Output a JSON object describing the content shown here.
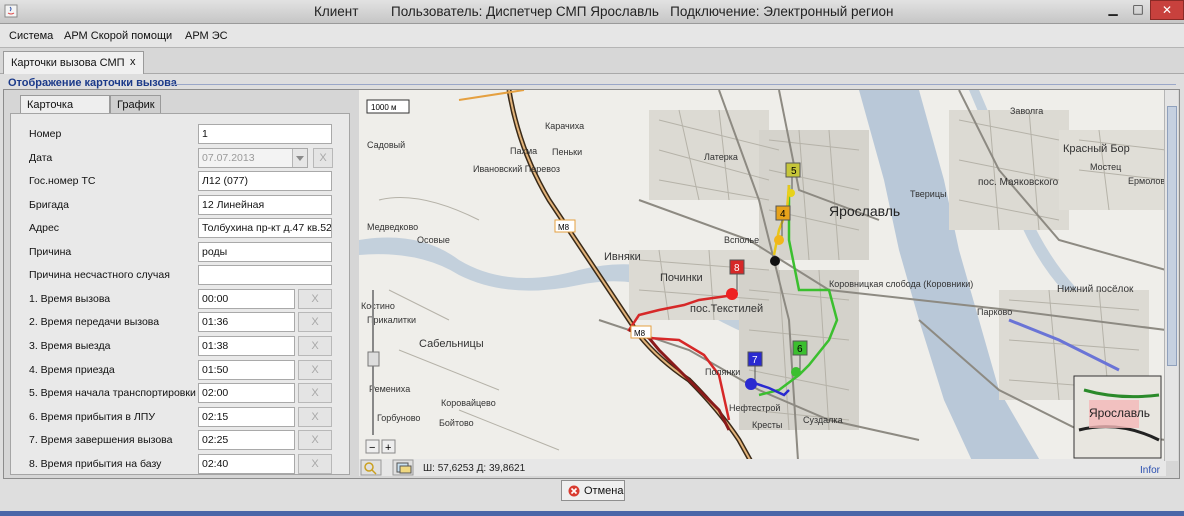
{
  "window": {
    "app_title": "Клиент",
    "session_info": "Пользователь: Диспетчер СМП Ярославль   Подключение: Электронный регион",
    "minimize_glyph": "▁",
    "maximize_glyph": "□",
    "close_glyph": "✕"
  },
  "menu": [
    "Система",
    "АРМ Скорой помощи",
    "АРМ ЭС"
  ],
  "doc_tab": {
    "label": "Карточки вызова СМП",
    "close": "x"
  },
  "section_title": "Отображение карточки вызова",
  "form_tabs": [
    "Карточка вызова",
    "График"
  ],
  "form": {
    "clear_label": "X",
    "fields": [
      {
        "label": "Номер",
        "value": "1"
      },
      {
        "label": "Дата",
        "value": "07.07.2013",
        "disabled": true
      },
      {
        "label": "Гос.номер ТС",
        "value": "Л12 (077)"
      },
      {
        "label": "Бригада",
        "value": "12 Линейная"
      },
      {
        "label": "Адрес",
        "value": "Толбухина пр-кт д.47 кв.52"
      },
      {
        "label": "Причина",
        "value": "роды"
      },
      {
        "label": "Причина несчастного случая",
        "value": ""
      },
      {
        "label": "1. Время вызова",
        "value": "00:00"
      },
      {
        "label": "2. Время передачи вызова",
        "value": "01:36"
      },
      {
        "label": "3. Время выезда",
        "value": "01:38"
      },
      {
        "label": "4. Время приезда",
        "value": "01:50"
      },
      {
        "label": "5. Время начала транспортировки",
        "value": "02:00"
      },
      {
        "label": "6. Время прибытия в ЛПУ",
        "value": "02:15"
      },
      {
        "label": "7. Время завершения вызова",
        "value": "02:25"
      },
      {
        "label": "8. Время прибытия на базу",
        "value": "02:40"
      }
    ]
  },
  "map": {
    "scale_label": "1000 м",
    "coords": "Ш: 57,6253  Д: 39,8621",
    "info_link": "Infor",
    "zoom_in": "+",
    "zoom_out": "−",
    "places": [
      "Карачиха",
      "Пахма",
      "Пеньки",
      "Садовый",
      "Ивановский Перевоз",
      "Медведково",
      "Осовые",
      "Ивняки",
      "Починки",
      "пос.Текстилей",
      "Сабельницы",
      "Костино",
      "Прикалитки",
      "Ремениха",
      "Горбуново",
      "Коровайцево",
      "Бойтово",
      "Полянки",
      "Нефтестрой",
      "Кресты",
      "Суздалка",
      "Латерка",
      "Всполье",
      "Ярославль",
      "Тверицы",
      "Коровницкая слобода (Коровники)",
      "Заволга",
      "Красный Бор",
      "Мостец",
      "Ермолово",
      "пос. Маяковского",
      "Нижний посёлок",
      "Парково"
    ],
    "road_labels": [
      "M8",
      "M8"
    ],
    "minimap_label": "Ярославль",
    "markers": [
      {
        "n": "5",
        "color": "#c6c63a"
      },
      {
        "n": "4",
        "color": "#e7a21a"
      },
      {
        "n": "8",
        "color": "#d62828"
      },
      {
        "n": "7",
        "color": "#2a2ad0"
      },
      {
        "n": "6",
        "color": "#3bbf2f"
      }
    ]
  },
  "cancel_label": "Отмена"
}
